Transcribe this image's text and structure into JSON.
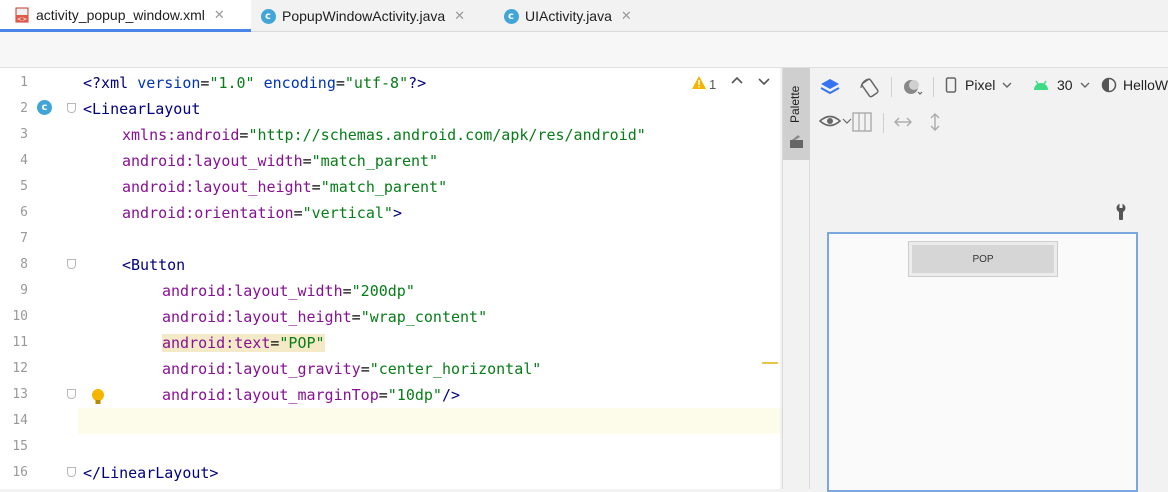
{
  "tabs": [
    {
      "label": "activity_popup_window.xml",
      "icon": "xml-file-icon",
      "active": true
    },
    {
      "label": "PopupWindowActivity.java",
      "icon": "class-c-icon",
      "active": false
    },
    {
      "label": "UIActivity.java",
      "icon": "class-c-icon",
      "active": false
    }
  ],
  "tab_close_glyph": "✕",
  "editor": {
    "current_line": 14,
    "warning_count": "1",
    "line_numbers": [
      "1",
      "2",
      "3",
      "4",
      "5",
      "6",
      "7",
      "8",
      "9",
      "10",
      "11",
      "12",
      "13",
      "14",
      "15",
      "16"
    ],
    "lines": {
      "l1": {
        "tag": "<?xml ",
        "a1": "version",
        "e1": "=",
        "v1": "\"1.0\"",
        "sp": " ",
        "a2": "encoding",
        "e2": "=",
        "v2": "\"utf-8\"",
        "end": "?>"
      },
      "l2": {
        "tag": "<LinearLayout"
      },
      "l3": {
        "ns": "xmlns:android",
        "eq": "=",
        "val": "\"http://schemas.android.com/apk/res/android\""
      },
      "l4": {
        "ns": "android:",
        "name": "layout_width",
        "eq": "=",
        "val": "\"match_parent\""
      },
      "l5": {
        "ns": "android:",
        "name": "layout_height",
        "eq": "=",
        "val": "\"match_parent\""
      },
      "l6": {
        "ns": "android:",
        "name": "orientation",
        "eq": "=",
        "val": "\"vertical\"",
        "end": ">"
      },
      "l8": {
        "tag": "<Button"
      },
      "l9": {
        "ns": "android:",
        "name": "layout_width",
        "eq": "=",
        "val": "\"200dp\""
      },
      "l10": {
        "ns": "android:",
        "name": "layout_height",
        "eq": "=",
        "val": "\"wrap_content\""
      },
      "l11": {
        "ns": "android:",
        "name": "text",
        "eq": "=",
        "val": "\"POP\""
      },
      "l12": {
        "ns": "android:",
        "name": "layout_gravity",
        "eq": "=",
        "val": "\"center_horizontal\""
      },
      "l13": {
        "ns": "android:",
        "name": "layout_marginTop",
        "eq": "=",
        "val": "\"10dp\"",
        "end": "/>"
      },
      "l16": {
        "tag": "</LinearLayout>"
      }
    }
  },
  "palette": {
    "label": "Palette"
  },
  "design_toolbar": {
    "device": "Pixel",
    "api": "30",
    "theme": "HelloW"
  },
  "preview": {
    "button_text": "POP"
  },
  "colors": {
    "accent": "#4a86e8",
    "string": "#067d17",
    "namespace": "#871094",
    "attribute": "#0033b3",
    "tag": "#000080"
  }
}
